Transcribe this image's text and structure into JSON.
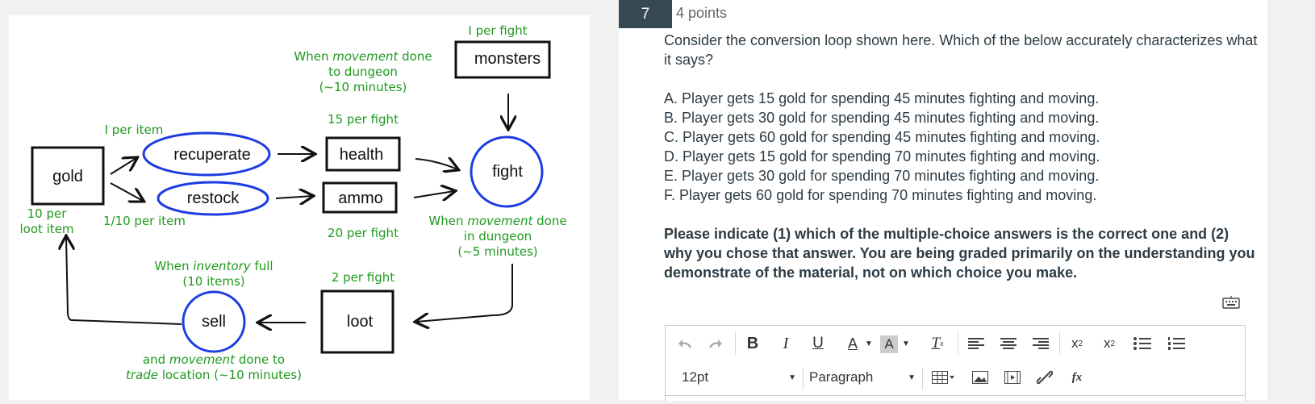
{
  "diagram": {
    "nodes": {
      "gold": "gold",
      "recuperate": "recuperate",
      "restock": "restock",
      "health": "health",
      "ammo": "ammo",
      "monsters": "monsters",
      "fight": "fight",
      "loot": "loot",
      "sell": "sell"
    },
    "notes": {
      "per_item": "I per item",
      "per_item_10": "1/10 per item",
      "per_loot_1": "10 per",
      "per_loot_2": "loot item",
      "health_rate": "15 per fight",
      "ammo_rate": "20 per fight",
      "monsters_rate": "I per fight",
      "loot_rate": "2 per fight",
      "move_dungeon_1a": "When ",
      "move_dungeon_1b": "movement",
      "move_dungeon_1c": " done",
      "move_dungeon_2": "to dungeon",
      "move_dungeon_3": "(~10 minutes)",
      "move_in_1a": "When ",
      "move_in_1b": "movement",
      "move_in_1c": " done",
      "move_in_2": "in dungeon",
      "move_in_3": "(~5 minutes)",
      "inv_1a": "When ",
      "inv_1b": "inventory",
      "inv_1c": " full",
      "inv_2": "(10 items)",
      "trade_1a": "and ",
      "trade_1b": "movement",
      "trade_1c": " done to",
      "trade_2a": "trade",
      "trade_2b": " location (~10 minutes)"
    }
  },
  "question": {
    "number": "7",
    "points": "4 points",
    "prompt": "Consider the conversion loop shown here. Which of the below accurately characterizes what it says?",
    "answers": [
      "A. Player gets 15 gold for spending 45 minutes fighting and moving.",
      "B. Player gets 30 gold for spending 45 minutes fighting and moving.",
      "C. Player gets 60 gold for spending 45 minutes fighting and moving.",
      "D. Player gets 15 gold for spending 70 minutes fighting and moving.",
      "E. Player gets 30 gold for spending 70 minutes fighting and moving.",
      "F. Player gets 60 gold for spending 70 minutes fighting and moving."
    ],
    "instructions": "Please indicate (1) which of the multiple-choice answers is the correct one and (2) why you chose that answer. You are being graded primarily on the understanding you demonstrate of the material, not on which choice you make."
  },
  "editor": {
    "font_size": "12pt",
    "block_format": "Paragraph",
    "icons": [
      "undo-icon",
      "redo-icon",
      "bold-icon",
      "italic-icon",
      "underline-icon",
      "text-color-icon",
      "background-color-icon",
      "clear-formatting-icon",
      "align-left-icon",
      "align-center-icon",
      "align-right-icon",
      "superscript-icon",
      "subscript-icon",
      "bullet-list-icon",
      "numbered-list-icon",
      "table-icon",
      "image-icon",
      "media-icon",
      "link-icon",
      "equation-icon",
      "keyboard-icon"
    ],
    "glyphs": {
      "bold": "B",
      "italic": "I",
      "underline": "U",
      "font_color": "A",
      "bg_color": "A",
      "clear": "T",
      "clear_sub": "x",
      "sup_x": "x",
      "sup_2": "2",
      "sub_x": "x",
      "sub_2": "2",
      "fx": "fx"
    }
  },
  "colors": {
    "accent_dark": "#374855",
    "note_green": "#1f9a1f",
    "circle_blue": "#1d3de0"
  }
}
